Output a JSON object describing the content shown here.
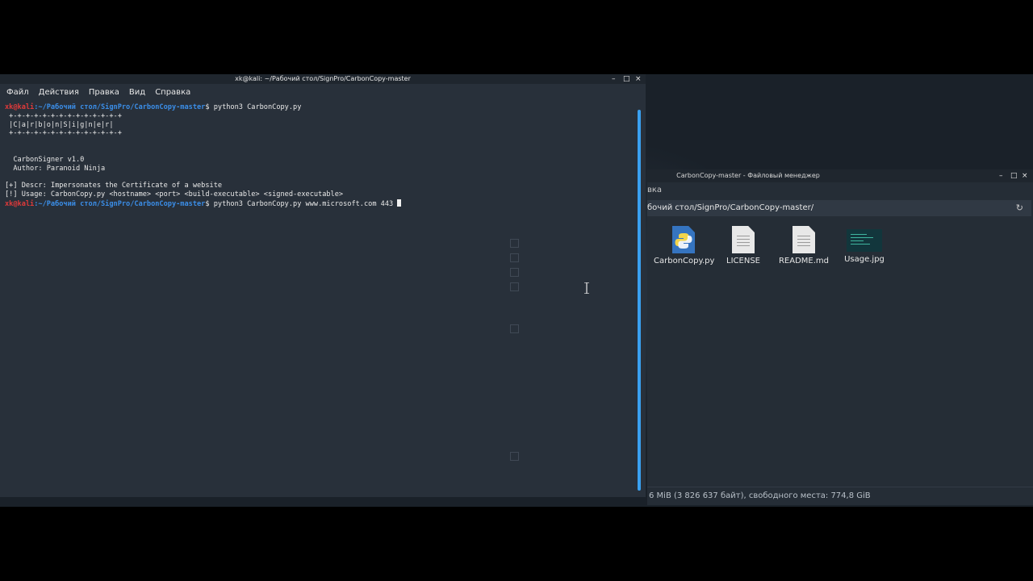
{
  "terminal": {
    "title": "xk@kali: ~/Рабочий стол/SignPro/CarbonCopy-master",
    "menu": [
      "Файл",
      "Действия",
      "Правка",
      "Вид",
      "Справка"
    ],
    "prompt_user": "xk@kali",
    "prompt_path": ":~/Рабочий стол/SignPro/CarbonCopy-master",
    "prompt_symbol": "$",
    "command1": " python3 CarbonCopy.py",
    "banner": [
      " +-+-+-+-+-+-+-+-+-+-+-+-+-+",
      " |C|a|r|b|o|n|S|i|g|n|e|r|",
      " +-+-+-+-+-+-+-+-+-+-+-+-+-+"
    ],
    "version": "  CarbonSigner v1.0",
    "author": "  Author: Paranoid Ninja",
    "descr": "[+] Descr: Impersonates the Certificate of a website",
    "usage": "[!] Usage: CarbonCopy.py <hostname> <port> <build-executable> <signed-executable>",
    "command2": " python3 CarbonCopy.py www.microsoft.com 443 "
  },
  "file_manager": {
    "title": "CarbonCopy-master - Файловый менеджер",
    "menu_fragment": "вка",
    "path": "бочий стол/SignPro/CarbonCopy-master/",
    "files": [
      {
        "name": "CarbonCopy.py",
        "icon": "python-file-icon"
      },
      {
        "name": "LICENSE",
        "icon": "text-file-icon"
      },
      {
        "name": "README.md",
        "icon": "text-file-icon"
      },
      {
        "name": "Usage.jpg",
        "icon": "image-file-icon"
      }
    ],
    "status": "6 MiB (3 826 637 байт), свободного места: 774,8 GiB"
  },
  "window_controls": {
    "minimize": "–",
    "maximize": "□",
    "close": "×"
  },
  "colors": {
    "prompt_user": "#e03a3a",
    "prompt_path": "#3b8ee8",
    "scrollbar": "#3aa0f0",
    "terminal_bg": "#28303a"
  }
}
